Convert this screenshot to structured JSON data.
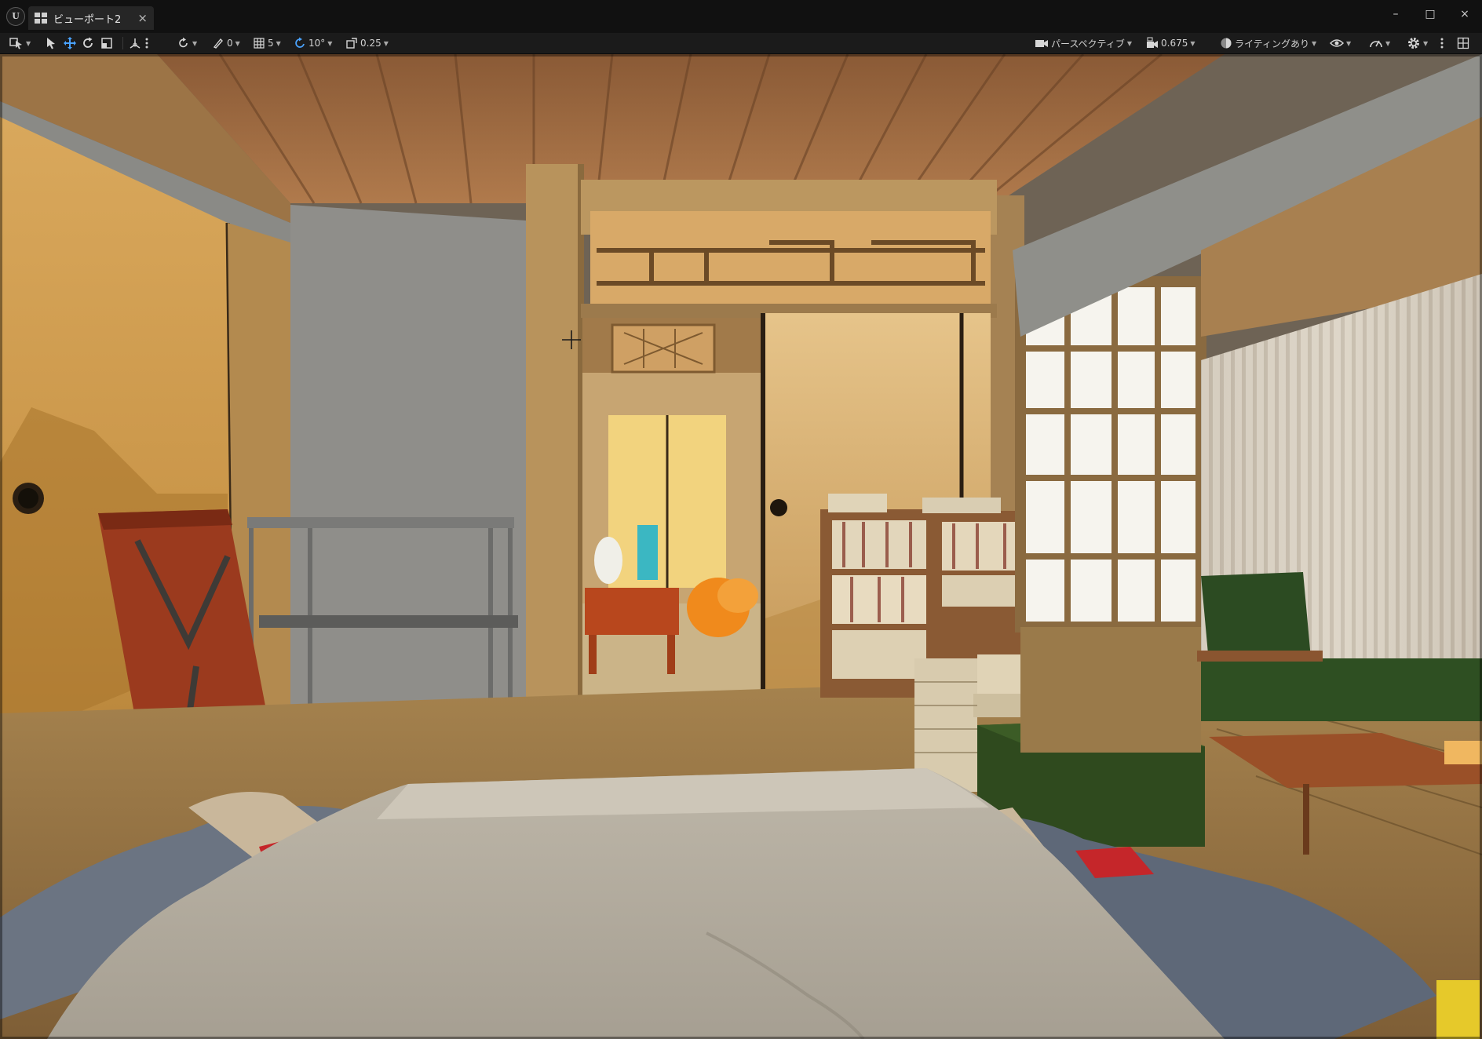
{
  "tab": {
    "label": "ビューポート2",
    "close": "×"
  },
  "window_controls": {
    "minimize": "–",
    "maximize": "□",
    "close": "×"
  },
  "toolbar": {
    "surface_snap_value": "0",
    "grid_snap_value": "5",
    "rotation_snap_value": "10°",
    "scale_snap_value": "0.25",
    "view_mode": "パースペクティブ",
    "camera_speed": "0.675",
    "lighting_mode": "ライティングあり"
  },
  "colors": {
    "titlebar": "#111111",
    "toolbar": "#1b1b1b",
    "accent": "#4aa3ff"
  }
}
